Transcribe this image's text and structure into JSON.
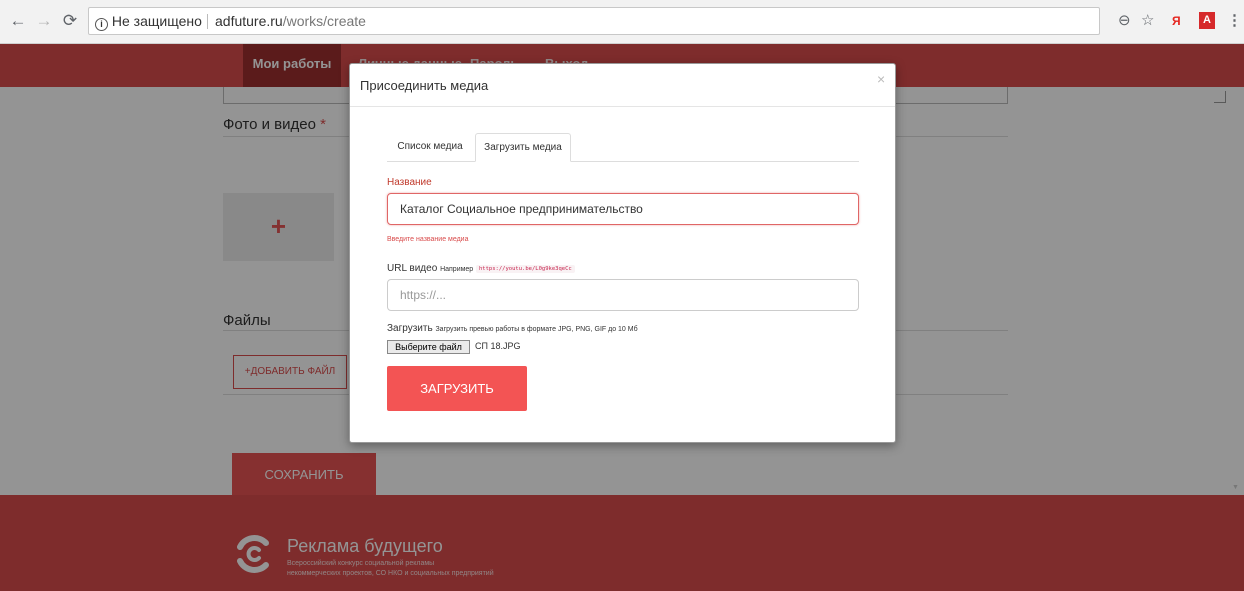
{
  "browser": {
    "security_label": "Не защищено",
    "url_host": "adfuture.ru",
    "url_path": "/works/create",
    "ext_label": "Я",
    "pdf_label": "A"
  },
  "site_nav": {
    "items": [
      {
        "label": "Мои работы"
      },
      {
        "label": "Личные данные"
      },
      {
        "label": "Пароль"
      },
      {
        "label": "Выход"
      }
    ]
  },
  "form": {
    "photo_label": "Фото и видео",
    "required_mark": "*",
    "add_photo_symbol": "+",
    "files_label": "Файлы",
    "add_file_label": "+ДОБАВИТЬ ФАЙЛ",
    "save_label": "СОХРАНИТЬ"
  },
  "modal": {
    "title": "Присоединить медиа",
    "close_symbol": "×",
    "tabs": [
      {
        "label": "Список медиа",
        "active": false
      },
      {
        "label": "Загрузить медиа",
        "active": true
      }
    ],
    "name_label": "Название",
    "name_value": "Каталог Социальное предпринимательство",
    "name_error": "Введите название медиа",
    "url_label": "URL видео",
    "url_hint_prefix": "Например",
    "url_hint_code": "https://youtu.be/L0g9ke3qeCc",
    "url_placeholder": "https://...",
    "upload_label": "Загрузить",
    "upload_hint": "Загрузить превью работы в формате JPG, PNG, GIF до 10 Мб",
    "file_button": "Выберите файл",
    "file_name": "СП 18.JPG",
    "submit_label": "ЗАГРУЗИТЬ"
  },
  "footer": {
    "title": "Реклама будущего",
    "subtitle_1": "Всероссийский конкурс социальной рекламы",
    "subtitle_2": "некоммерческих проектов, СО НКО и социальных предприятий"
  },
  "colors": {
    "brand_red": "#d94c4c",
    "upload_red": "#f35454",
    "dark_red": "#9e2f2f"
  },
  "icons": [
    "back-arrow-icon",
    "forward-arrow-icon",
    "reload-icon",
    "info-icon",
    "zoom-icon",
    "star-icon",
    "pdf-icon",
    "menu-dots-icon",
    "logo-icon"
  ]
}
